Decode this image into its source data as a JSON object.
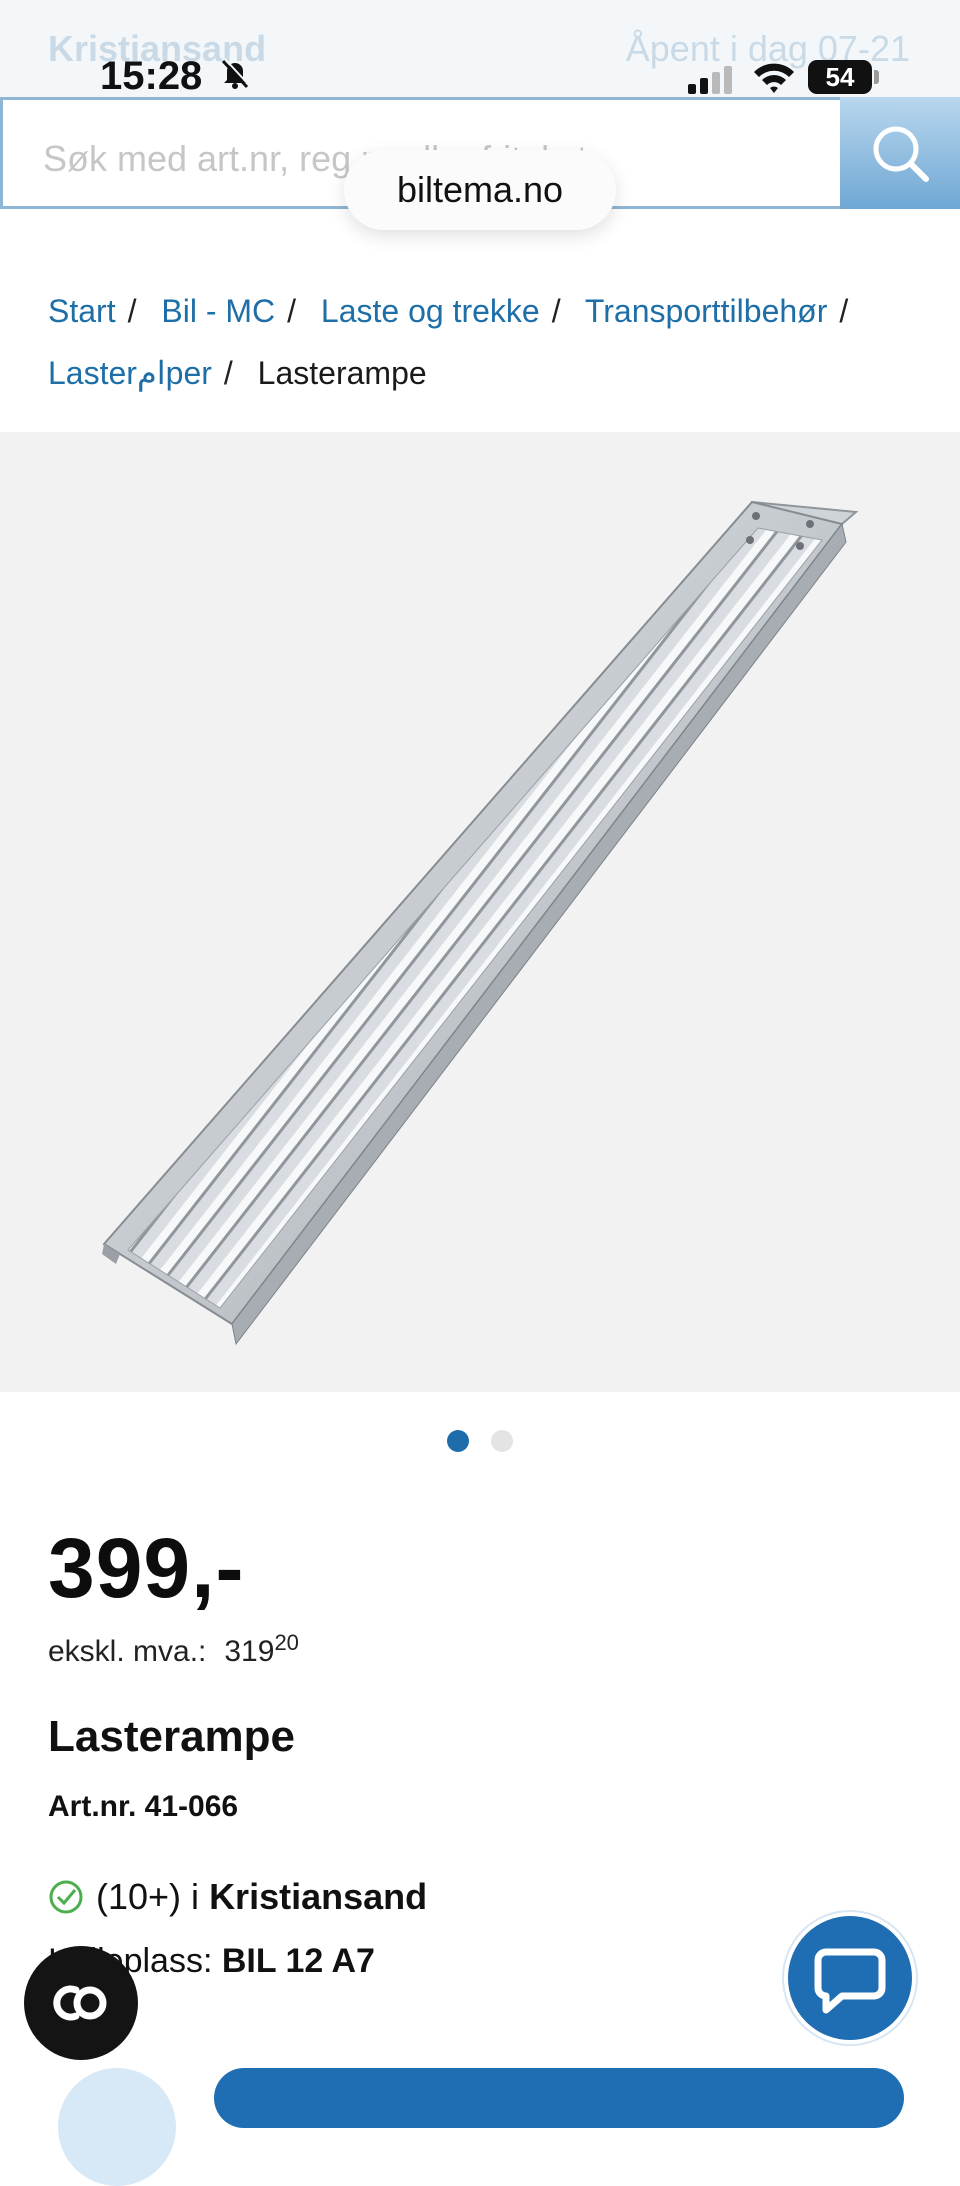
{
  "store": {
    "name": "Kristiansand",
    "hours": "Åpent i dag 07-21"
  },
  "status_bar": {
    "time": "15:28",
    "battery": "54"
  },
  "search": {
    "placeholder": "Søk med art.nr, reg.nr eller fritekst"
  },
  "browser": {
    "url": "biltema.no"
  },
  "breadcrumb": {
    "items": [
      "Start",
      "Bil - MC",
      "Laste og trekke",
      "Transporttilbehør",
      "Lasterامper"
    ],
    "current": "Lasterampe",
    "separator": "/"
  },
  "product": {
    "price": "399,-",
    "vat_label": "ekskl. mva.:",
    "vat_amount": "319",
    "vat_decimals": "20",
    "title": "Lasterampe",
    "art_nr": "Art.nr. 41-066",
    "stock_count": "(10+) i",
    "stock_store": "Kristiansand",
    "shelf_label": "Hylleplass:",
    "shelf_value": "BIL 12 A7"
  },
  "gallery": {
    "image_count": 2,
    "active_index": 0
  },
  "colors": {
    "link": "#1e6fa8",
    "accent": "#1f6db2",
    "check": "#4cae4c"
  }
}
